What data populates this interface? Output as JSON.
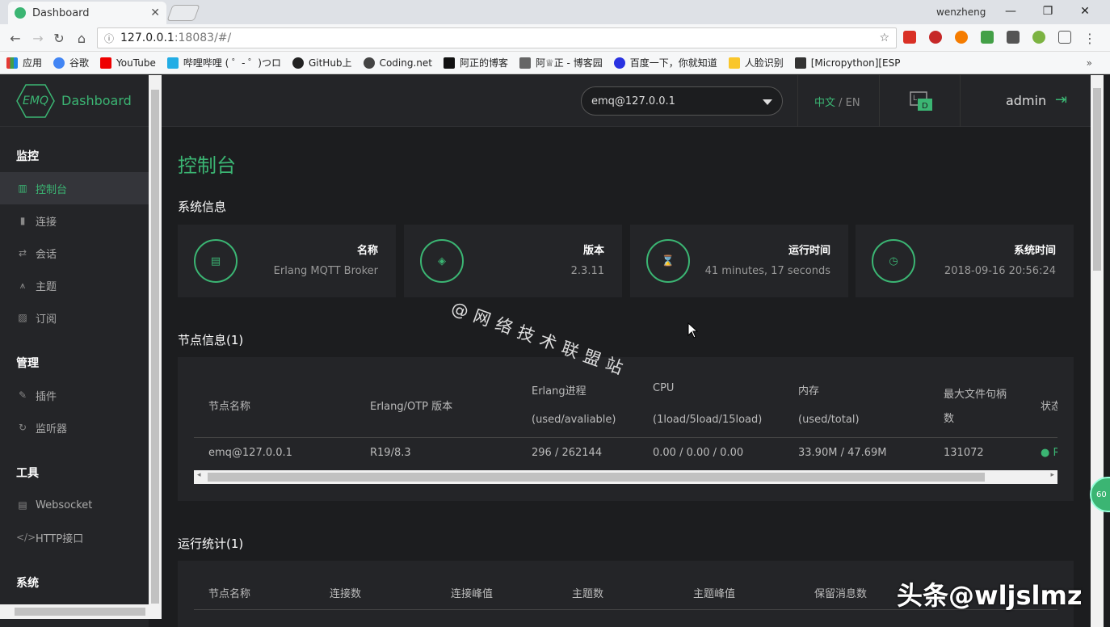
{
  "browser": {
    "tab_title": "Dashboard",
    "user": "wenzheng",
    "url_host": "127.0.0.1",
    "url_rest": ":18083/#/",
    "bookmarks": [
      "应用",
      "谷歌",
      "YouTube",
      "哔哩哔哩 ( ゜- ゜)つロ",
      "GitHub上",
      "Coding.net",
      "阿正的博客",
      "阿♕正 - 博客园",
      "百度一下，你就知道",
      "人脸识别",
      "[Micropython][ESP"
    ]
  },
  "sidebar": {
    "logo_text": "EMQ",
    "title": "Dashboard",
    "groups": [
      {
        "label": "监控",
        "items": [
          "控制台",
          "连接",
          "会话",
          "主题",
          "订阅"
        ]
      },
      {
        "label": "管理",
        "items": [
          "插件",
          "监听器"
        ]
      },
      {
        "label": "工具",
        "items": [
          "Websocket",
          "HTTP接口"
        ]
      },
      {
        "label": "系统"
      }
    ]
  },
  "header": {
    "node": "emq@127.0.0.1",
    "lang_zh": "中文",
    "lang_sep": " / ",
    "lang_en": "EN",
    "user": "admin"
  },
  "main": {
    "page_title": "控制台",
    "system_info_title": "系统信息",
    "cards": [
      {
        "label": "名称",
        "value": "Erlang MQTT Broker"
      },
      {
        "label": "版本",
        "value": "2.3.11"
      },
      {
        "label": "运行时间",
        "value": "41 minutes, 17 seconds"
      },
      {
        "label": "系统时间",
        "value": "2018-09-16 20:56:24"
      }
    ],
    "node_info_title": "节点信息(1)",
    "node_headers": {
      "name": "节点名称",
      "otp": "Erlang/OTP 版本",
      "proc1": "Erlang进程",
      "proc2": "(used/avaliable)",
      "cpu1": "CPU",
      "cpu2": "(1load/5load/15load)",
      "mem1": "内存",
      "mem2": "(used/total)",
      "fd1": "最大文件句柄",
      "fd2": "数",
      "status": "状态"
    },
    "node_row": {
      "name": "emq@127.0.0.1",
      "otp": "R19/8.3",
      "proc": "296 / 262144",
      "cpu": "0.00 / 0.00 / 0.00",
      "mem": "33.90M / 47.69M",
      "fd": "131072",
      "status": "R"
    },
    "stats_title": "运行统计(1)",
    "stats_headers": [
      "节点名称",
      "连接数",
      "连接峰值",
      "主题数",
      "主题峰值",
      "保留消息数"
    ]
  },
  "overlay": {
    "watermark": "@网络技术联盟站",
    "brand": "头条@wljslmz",
    "badge": "60"
  },
  "colors": {
    "accent": "#3bb573",
    "bg": "#1c1d1f",
    "panel": "#242528"
  }
}
